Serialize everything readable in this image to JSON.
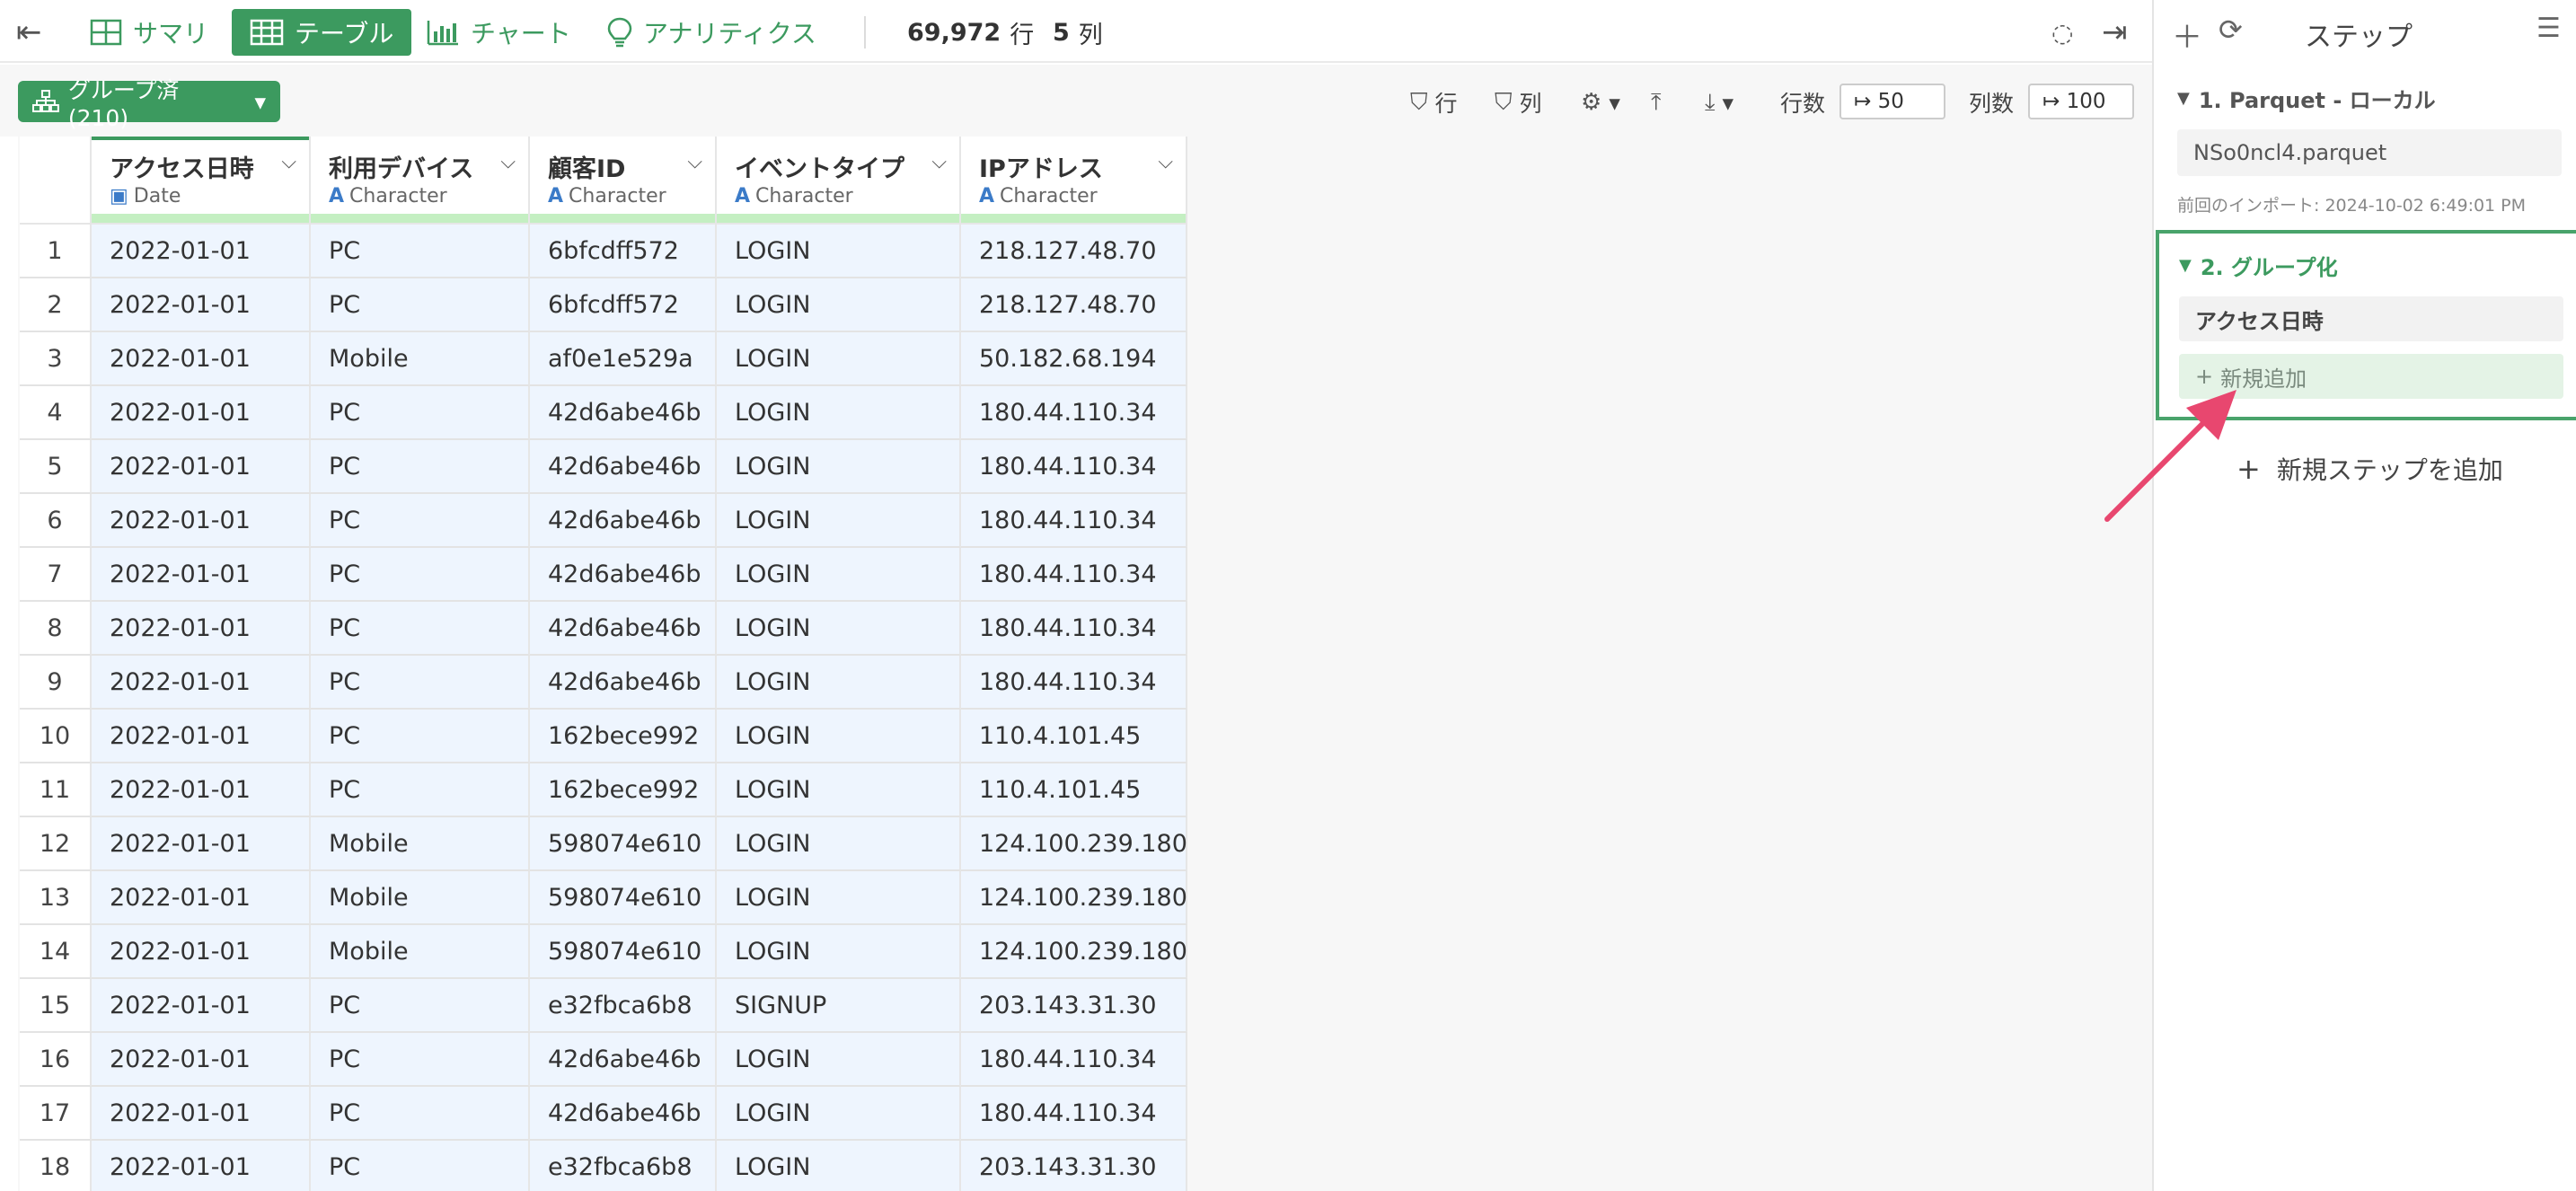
{
  "topbar": {
    "tabs": [
      {
        "label": "サマリ",
        "icon": "grid-icon"
      },
      {
        "label": "テーブル",
        "icon": "table-icon"
      },
      {
        "label": "チャート",
        "icon": "bar-chart-icon"
      },
      {
        "label": "アナリティクス",
        "icon": "lightbulb-icon"
      }
    ],
    "row_count": "69,972",
    "row_unit": "行",
    "col_count": "5",
    "col_unit": "列"
  },
  "toolbar": {
    "group_label": "グループ済 (210)",
    "filter_row": "行",
    "filter_col": "列",
    "rows_label": "行数",
    "rows_value": "50",
    "cols_label": "列数",
    "cols_value": "100"
  },
  "table": {
    "columns": [
      {
        "name": "アクセス日時",
        "type": "Date"
      },
      {
        "name": "利用デバイス",
        "type": "Character"
      },
      {
        "name": "顧客ID",
        "type": "Character"
      },
      {
        "name": "イベントタイプ",
        "type": "Character"
      },
      {
        "name": "IPアドレス",
        "type": "Character"
      }
    ],
    "rows": [
      [
        "1",
        "2022-01-01",
        "PC",
        "6bfcdff572",
        "LOGIN",
        "218.127.48.70"
      ],
      [
        "2",
        "2022-01-01",
        "PC",
        "6bfcdff572",
        "LOGIN",
        "218.127.48.70"
      ],
      [
        "3",
        "2022-01-01",
        "Mobile",
        "af0e1e529a",
        "LOGIN",
        "50.182.68.194"
      ],
      [
        "4",
        "2022-01-01",
        "PC",
        "42d6abe46b",
        "LOGIN",
        "180.44.110.34"
      ],
      [
        "5",
        "2022-01-01",
        "PC",
        "42d6abe46b",
        "LOGIN",
        "180.44.110.34"
      ],
      [
        "6",
        "2022-01-01",
        "PC",
        "42d6abe46b",
        "LOGIN",
        "180.44.110.34"
      ],
      [
        "7",
        "2022-01-01",
        "PC",
        "42d6abe46b",
        "LOGIN",
        "180.44.110.34"
      ],
      [
        "8",
        "2022-01-01",
        "PC",
        "42d6abe46b",
        "LOGIN",
        "180.44.110.34"
      ],
      [
        "9",
        "2022-01-01",
        "PC",
        "42d6abe46b",
        "LOGIN",
        "180.44.110.34"
      ],
      [
        "10",
        "2022-01-01",
        "PC",
        "162bece992",
        "LOGIN",
        "110.4.101.45"
      ],
      [
        "11",
        "2022-01-01",
        "PC",
        "162bece992",
        "LOGIN",
        "110.4.101.45"
      ],
      [
        "12",
        "2022-01-01",
        "Mobile",
        "598074e610",
        "LOGIN",
        "124.100.239.180"
      ],
      [
        "13",
        "2022-01-01",
        "Mobile",
        "598074e610",
        "LOGIN",
        "124.100.239.180"
      ],
      [
        "14",
        "2022-01-01",
        "Mobile",
        "598074e610",
        "LOGIN",
        "124.100.239.180"
      ],
      [
        "15",
        "2022-01-01",
        "PC",
        "e32fbca6b8",
        "SIGNUP",
        "203.143.31.30"
      ],
      [
        "16",
        "2022-01-01",
        "PC",
        "42d6abe46b",
        "LOGIN",
        "180.44.110.34"
      ],
      [
        "17",
        "2022-01-01",
        "PC",
        "42d6abe46b",
        "LOGIN",
        "180.44.110.34"
      ],
      [
        "18",
        "2022-01-01",
        "PC",
        "e32fbca6b8",
        "LOGIN",
        "203.143.31.30"
      ]
    ]
  },
  "steps": {
    "title": "ステップ",
    "step1_title": "1. Parquet - ローカル",
    "step1_file": "NSo0ncl4.parquet",
    "step1_note": "前回のインポート: 2024-10-02 6:49:01 PM",
    "step2_title": "2. グループ化",
    "step2_key": "アクセス日時",
    "step2_add": "新規追加",
    "add_step": "新規ステップを追加"
  },
  "colors": {
    "accent": "#3c9a5f",
    "cell_bg": "#eef5fe",
    "header_bar": "#c4efc2",
    "arrow": "#e8476f"
  }
}
